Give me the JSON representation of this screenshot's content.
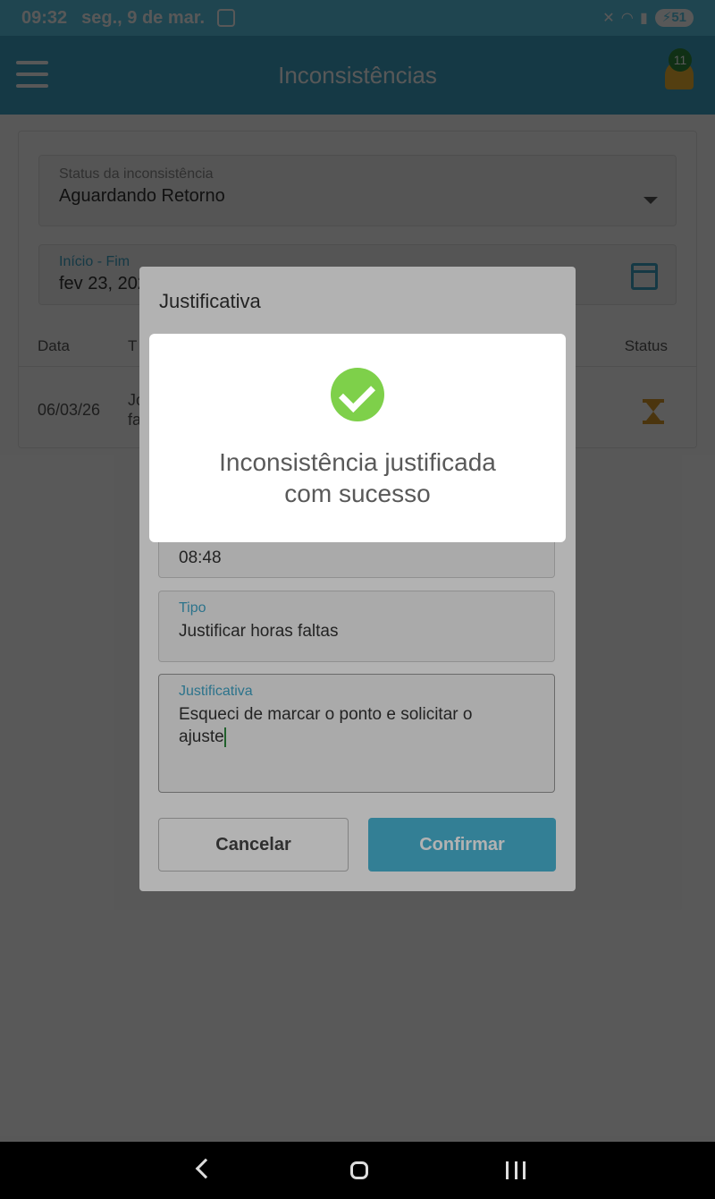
{
  "status_bar": {
    "time": "09:32",
    "date": "seg., 9 de mar.",
    "battery": "51"
  },
  "app_bar": {
    "title": "Inconsistências",
    "notification_count": "11"
  },
  "filters": {
    "status_label": "Status da inconsistência",
    "status_value": "Aguardando Retorno",
    "period_label": "Início - Fim",
    "period_value": "fev 23, 202"
  },
  "table": {
    "headers": [
      "Data",
      "T",
      "Status"
    ],
    "rows": [
      {
        "date": "06/03/26",
        "desc_line1": "Jo",
        "desc_line2": "fa",
        "status_icon": "hourglass-icon"
      }
    ]
  },
  "dialog": {
    "title": "Justificativa",
    "hour_value": "08:48",
    "type_label": "Tipo",
    "type_value": "Justificar horas faltas",
    "justification_label": "Justificativa",
    "justification_value": "Esqueci de marcar o ponto e solicitar o ajuste",
    "cancel_label": "Cancelar",
    "confirm_label": "Confirmar"
  },
  "toast": {
    "message_line1": "Inconsistência justificada",
    "message_line2": "com sucesso",
    "icon": "check-circle-icon"
  },
  "colors": {
    "primary": "#3fa5c8",
    "success": "#7ed04a",
    "warning": "#d99a2b"
  }
}
